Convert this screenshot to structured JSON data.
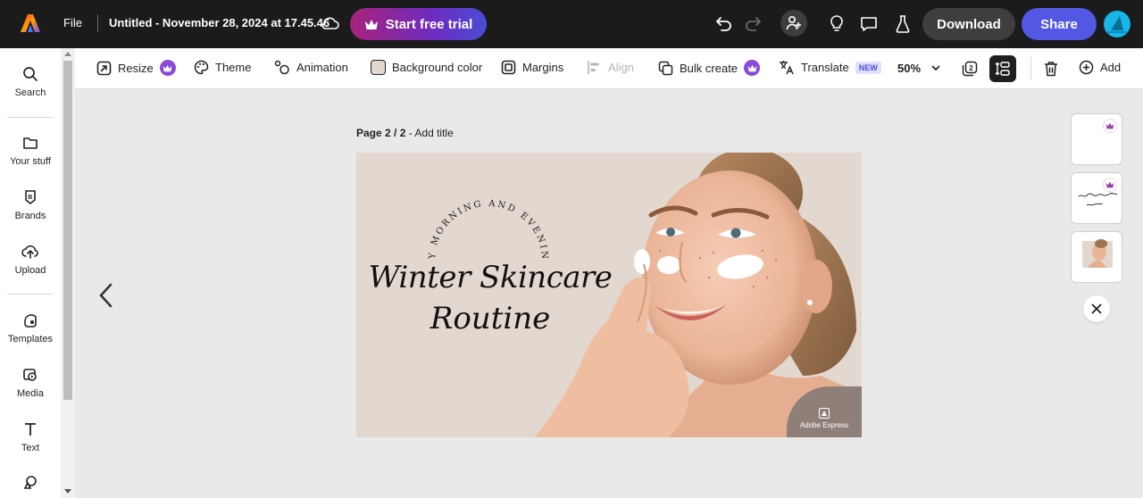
{
  "header": {
    "file_label": "File",
    "document_title": "Untitled - November 28, 2024 at 17.45.46",
    "trial_label": "Start free trial",
    "download_label": "Download",
    "share_label": "Share"
  },
  "sidebar": {
    "items": [
      {
        "label": "Search",
        "icon": "search-icon"
      },
      {
        "label": "Your stuff",
        "icon": "folder-icon"
      },
      {
        "label": "Brands",
        "icon": "brand-icon"
      },
      {
        "label": "Upload",
        "icon": "upload-icon"
      },
      {
        "label": "Templates",
        "icon": "templates-icon"
      },
      {
        "label": "Media",
        "icon": "media-icon"
      },
      {
        "label": "Text",
        "icon": "text-icon"
      },
      {
        "label": "",
        "icon": "elements-icon"
      }
    ]
  },
  "toolbar": {
    "resize": "Resize",
    "theme": "Theme",
    "animation": "Animation",
    "background_color": "Background color",
    "margins": "Margins",
    "align": "Align",
    "bulk_create": "Bulk create",
    "translate": "Translate",
    "new_badge": "NEW",
    "zoom": "50%",
    "add": "Add"
  },
  "canvas": {
    "page_number": "Page 2 / 2",
    "page_title_prompt": "Add title",
    "arc_text": "MY MORNING AND EVENING",
    "headline_line1": "Winter Skincare",
    "headline_line2": "Routine",
    "watermark": "Adobe Express"
  },
  "colors": {
    "topbar": "#1b1b1b",
    "accent": "#5258e4",
    "premium": "#8b4bd8",
    "artboard_bg": "#e3d8cf"
  }
}
